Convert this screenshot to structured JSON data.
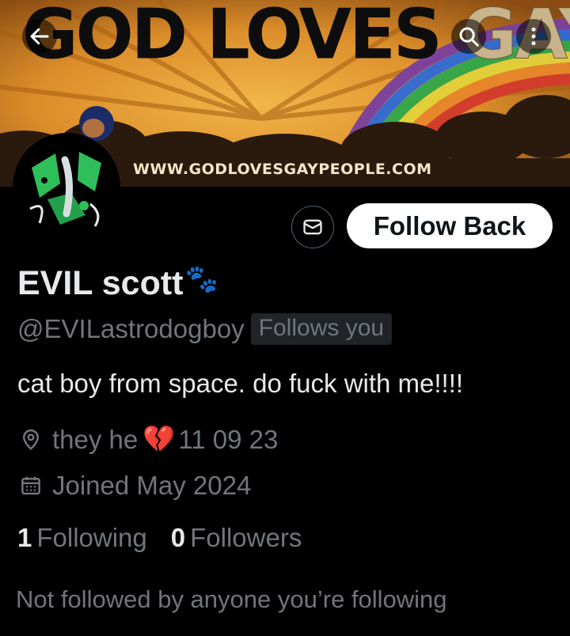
{
  "banner": {
    "title_part1": "GOD LOVES ",
    "title_part2": "GAYS",
    "url": "WWW.GODLOVESGAYPEOPLE.COM",
    "colors": {
      "sky": "#e0962f",
      "rays": "#b46a14",
      "clouds": "#2a1a0d"
    }
  },
  "header": {
    "back_icon": "arrow-left-icon",
    "search_icon": "search-icon",
    "more_icon": "more-vertical-icon"
  },
  "actions": {
    "message_icon": "message-envelope-icon",
    "follow_back_label": "Follow Back"
  },
  "profile": {
    "display_name": "EVIL scott",
    "name_emoji": "🐾",
    "handle": "@EVILastrodogboy",
    "follows_you_badge": "Follows you",
    "bio": "cat boy from space. do fuck with me!!!!",
    "location_prefix": "they he",
    "location_emoji": "💔",
    "location_suffix": "11 09 23",
    "joined": "Joined May 2024"
  },
  "stats": {
    "following_count": "1",
    "following_label": "Following",
    "followers_count": "0",
    "followers_label": "Followers"
  },
  "not_followed_text": "Not followed by anyone you’re following",
  "colors": {
    "background": "#000000",
    "primary_text": "#e7e9ea",
    "secondary_text": "#71767b",
    "badge_bg": "#202327",
    "button_bg": "#ffffff",
    "heart": "#f06292"
  }
}
